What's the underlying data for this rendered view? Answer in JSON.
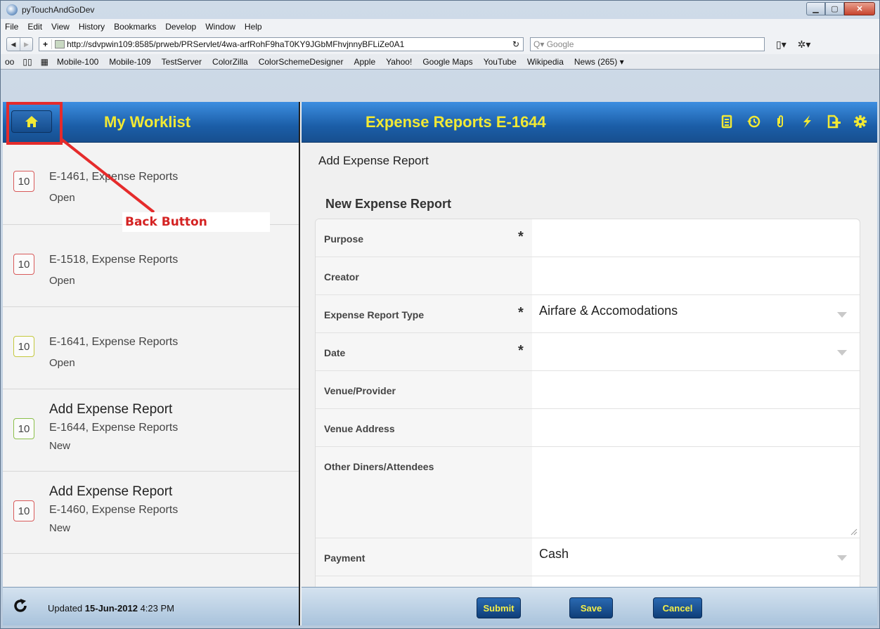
{
  "browser": {
    "window_title": "pyTouchAndGoDev",
    "menu": [
      "File",
      "Edit",
      "View",
      "History",
      "Bookmarks",
      "Develop",
      "Window",
      "Help"
    ],
    "url": "http://sdvpwin109:8585/prweb/PRServlet/4wa-arfRohF9haT0KY9JGbMFhvjnnyBFLiZe0A1",
    "search_placeholder": "Google",
    "bookmarks": [
      "Mobile-100",
      "Mobile-109",
      "TestServer",
      "ColorZilla",
      "ColorSchemeDesigner",
      "Apple",
      "Yahoo!",
      "Google Maps",
      "YouTube",
      "Wikipedia",
      "News (265) ▾"
    ]
  },
  "worklist": {
    "title": "My Worklist",
    "items": [
      {
        "heading": "",
        "badge": "10",
        "badge_color": "red",
        "title": "E-1461, Expense Reports",
        "status": "Open"
      },
      {
        "heading": "",
        "badge": "10",
        "badge_color": "red",
        "title": "E-1518, Expense Reports",
        "status": "Open"
      },
      {
        "heading": "",
        "badge": "10",
        "badge_color": "yellow",
        "title": "E-1641, Expense Reports",
        "status": "Open"
      },
      {
        "heading": "Add Expense Report",
        "badge": "10",
        "badge_color": "green",
        "title": "E-1644, Expense Reports",
        "status": "New"
      },
      {
        "heading": "Add Expense Report",
        "badge": "10",
        "badge_color": "red",
        "title": "E-1460, Expense Reports",
        "status": "New"
      }
    ],
    "footer_prefix": "Updated",
    "footer_date": "15-Jun-2012",
    "footer_time": "4:23 PM"
  },
  "annotation": {
    "label": "Back Button",
    "color": "#e52b2b"
  },
  "case": {
    "title": "Expense Reports E-1644",
    "page_heading": "Add Expense Report",
    "section_heading": "New Expense Report",
    "header_icons": [
      "document-icon",
      "history-icon",
      "attachment-icon",
      "flash-icon",
      "add-page-icon",
      "gear-icon"
    ],
    "fields": [
      {
        "label": "Purpose",
        "required": "*",
        "value": ""
      },
      {
        "label": "Creator",
        "required": "",
        "value": ""
      },
      {
        "label": "Expense Report Type",
        "required": "*",
        "value": "Airfare & Accomodations"
      },
      {
        "label": "Date",
        "required": "*",
        "value": ""
      },
      {
        "label": "Venue/Provider",
        "required": "",
        "value": ""
      },
      {
        "label": "Venue Address",
        "required": "",
        "value": ""
      },
      {
        "label": "Other Diners/Attendees",
        "required": "",
        "value": ""
      },
      {
        "label": "Payment",
        "required": "",
        "value": "Cash"
      }
    ],
    "buttons": {
      "submit": "Submit",
      "save": "Save",
      "cancel": "Cancel"
    }
  },
  "colors": {
    "header_blue": "#1b5ea8",
    "title_yellow": "#f2e934"
  }
}
